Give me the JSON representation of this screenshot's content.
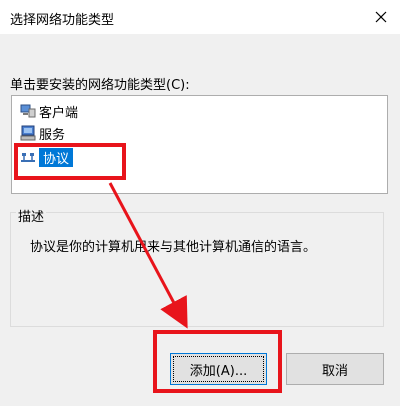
{
  "window": {
    "title": "选择网络功能类型",
    "close_label": "✕"
  },
  "prompt": {
    "label": "单击要安装的网络功能类型(C):"
  },
  "feature_list": {
    "items": [
      {
        "label": "客户端",
        "icon": "client-icon",
        "selected": false
      },
      {
        "label": "服务",
        "icon": "service-icon",
        "selected": false
      },
      {
        "label": "协议",
        "icon": "protocol-icon",
        "selected": true
      }
    ]
  },
  "description": {
    "title": "描述",
    "text": "协议是你的计算机用来与其他计算机通信的语言。"
  },
  "buttons": {
    "add_label": "添加(A)...",
    "cancel_label": "取消"
  },
  "colors": {
    "selection": "#0078d7",
    "highlight": "#e8141b",
    "dialog_bg": "#f0f0f0"
  }
}
